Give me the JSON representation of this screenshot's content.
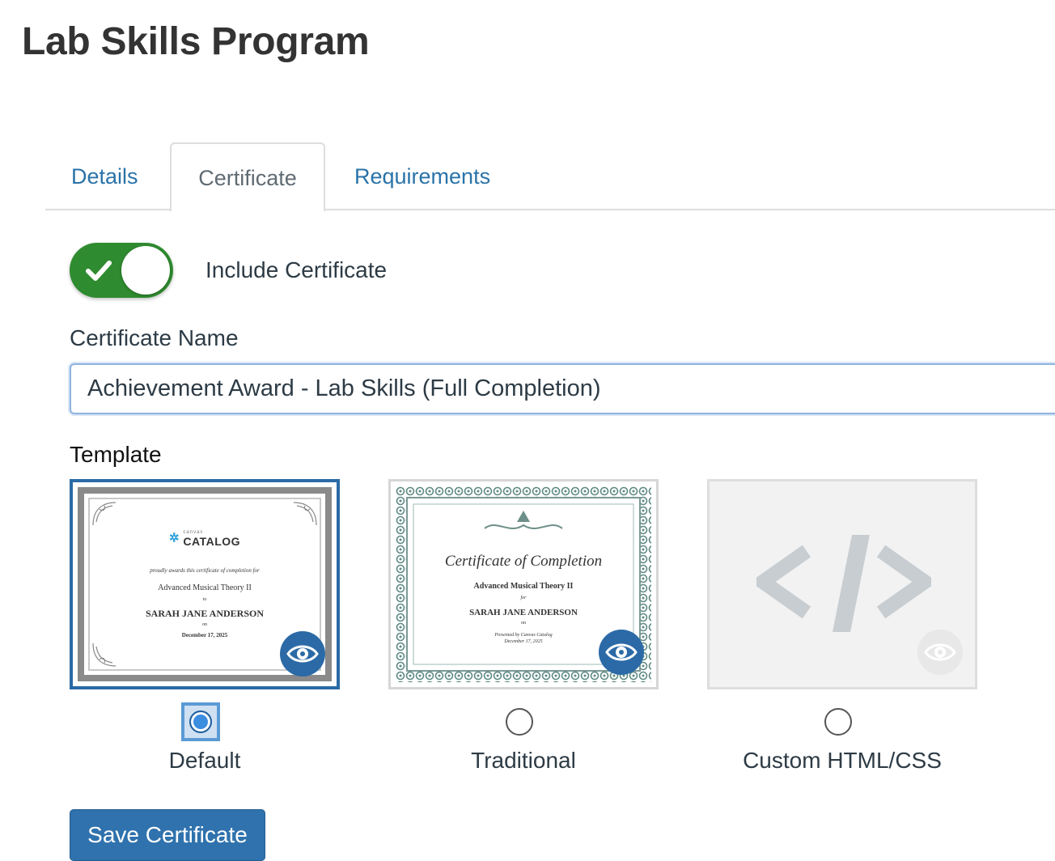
{
  "page": {
    "title": "Lab Skills Program"
  },
  "tabs": [
    {
      "label": "Details"
    },
    {
      "label": "Certificate",
      "active": true
    },
    {
      "label": "Requirements"
    }
  ],
  "toggle": {
    "label": "Include Certificate",
    "on": true,
    "on_color": "#2f8b2f"
  },
  "certificate_name": {
    "label": "Certificate Name",
    "value": "Achievement Award - Lab Skills (Full Completion)"
  },
  "template": {
    "label": "Template",
    "selected": "Default",
    "options": [
      {
        "label": "Default",
        "preview": {
          "logo_small": "canvas",
          "logo": "CATALOG",
          "line1": "proudly awards this certificate of completion for",
          "course": "Advanced Musical Theory II",
          "to": "to",
          "name": "SARAH JANE ANDERSON",
          "on": "on",
          "date": "December 17, 2025"
        }
      },
      {
        "label": "Traditional",
        "preview": {
          "heading": "Certificate of Completion",
          "course": "Advanced Musical Theory II",
          "for": "for",
          "name": "SARAH JANE ANDERSON",
          "on": "on",
          "presented": "Presented by Canvas Catalog",
          "date": "December 17, 2025"
        }
      },
      {
        "label": "Custom HTML/CSS",
        "preview": {
          "code_glyph": "</>"
        }
      }
    ]
  },
  "save_button": {
    "label": "Save Certificate"
  },
  "colors": {
    "accent": "#2b6aa6",
    "link": "#2a73a9",
    "button": "#2f72ad"
  },
  "icons": [
    "check-icon",
    "eye-icon",
    "code-icon",
    "ornament-icon"
  ]
}
